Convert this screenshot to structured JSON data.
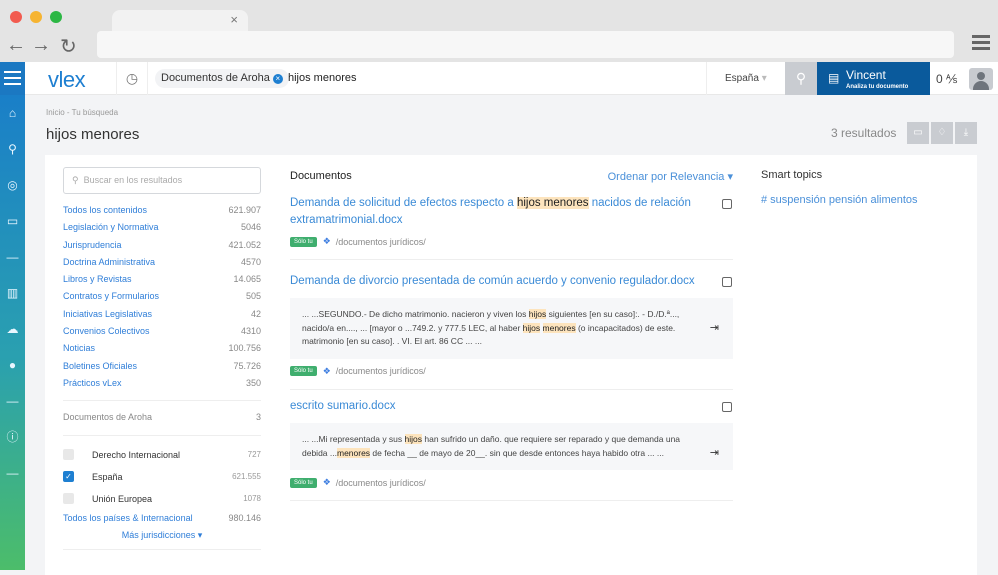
{
  "browser": {
    "tab_close": "×",
    "back": "←",
    "forward": "→",
    "reload": "↻"
  },
  "header": {
    "logo": "vlex",
    "chip": "Documentos de Aroha",
    "chip_close": "×",
    "query": "hijos menores",
    "country": "España",
    "country_caret": "▾",
    "vincent_name": "Vincent",
    "vincent_sub": "Analiza tu documento",
    "credits": "0 ⅍"
  },
  "breadcrumb": "Inicio -  Tu búsqueda",
  "page_title": "hijos menores",
  "results_count": "3 resultados",
  "facets": {
    "search_placeholder": "Buscar en los resultados",
    "types": [
      {
        "label": "Todos los contenidos",
        "count": "621.907"
      },
      {
        "label": "Legislación y Normativa",
        "count": "5046"
      },
      {
        "label": "Jurisprudencia",
        "count": "421.052"
      },
      {
        "label": "Doctrina Administrativa",
        "count": "4570"
      },
      {
        "label": "Libros y Revistas",
        "count": "14.065"
      },
      {
        "label": "Contratos y Formularios",
        "count": "505"
      },
      {
        "label": "Iniciativas Legislativas",
        "count": "42"
      },
      {
        "label": "Convenios Colectivos",
        "count": "4310"
      },
      {
        "label": "Noticias",
        "count": "100.756"
      },
      {
        "label": "Boletines Oficiales",
        "count": "75.726"
      },
      {
        "label": "Prácticos vLex",
        "count": "350"
      }
    ],
    "own_docs": {
      "label": "Documentos de Aroha",
      "count": "3"
    },
    "jurisdictions": [
      {
        "label": "Derecho Internacional",
        "count": "727",
        "checked": false
      },
      {
        "label": "España",
        "count": "621.555",
        "checked": true
      },
      {
        "label": "Unión Europea",
        "count": "1078",
        "checked": false
      }
    ],
    "all_countries": {
      "label": "Todos los países & Internacional",
      "count": "980.146"
    },
    "more": "Más jurisdicciones ▾"
  },
  "docs": {
    "heading": "Documentos",
    "sort": "Ordenar por Relevancia ▾",
    "items": [
      {
        "title": [
          {
            "t": "Demanda de solicitud de efectos respecto a "
          },
          {
            "t": "hijos menores",
            "hl": true
          },
          {
            "t": " nacidos de relación extramatrimonial.docx"
          }
        ],
        "snippet": null,
        "badge": "Sólo tu",
        "path": "/documentos jurídicos/"
      },
      {
        "title": [
          {
            "t": "Demanda de divorcio presentada de común acuerdo y convenio regulador.docx"
          }
        ],
        "snippet": [
          {
            "t": "... ...SEGUNDO.- De dicho matrimonio. nacieron y viven los "
          },
          {
            "t": "hijos",
            "hl": true
          },
          {
            "t": " siguientes [en su caso]:. - D./D.ª..., nacido/a en...., ... [mayor o ...749.2. y 777.5 LEC, al haber "
          },
          {
            "t": "hijos",
            "hl": true
          },
          {
            "t": " "
          },
          {
            "t": "menores",
            "hl": true
          },
          {
            "t": " (o incapacitados) de este. matrimonio [en su caso]. . VI. El art. 86 CC ... ..."
          }
        ],
        "badge": "Sólo tu",
        "path": "/documentos jurídicos/"
      },
      {
        "title": [
          {
            "t": "escrito sumario.docx"
          }
        ],
        "snippet": [
          {
            "t": "... ...Mi representada y sus "
          },
          {
            "t": "hijos",
            "hl": true
          },
          {
            "t": " han sufrido un daño. que requiere ser reparado y que demanda una debida ..."
          },
          {
            "t": "menores",
            "hl": true
          },
          {
            "t": " de fecha __ de mayo de 20__. sin que desde entonces haya habido otra ... ..."
          }
        ],
        "badge": "Sólo tu",
        "path": "/documentos jurídicos/"
      }
    ]
  },
  "smart_topics": {
    "heading": "Smart topics",
    "items": [
      "# suspensión pensión alimentos"
    ]
  }
}
